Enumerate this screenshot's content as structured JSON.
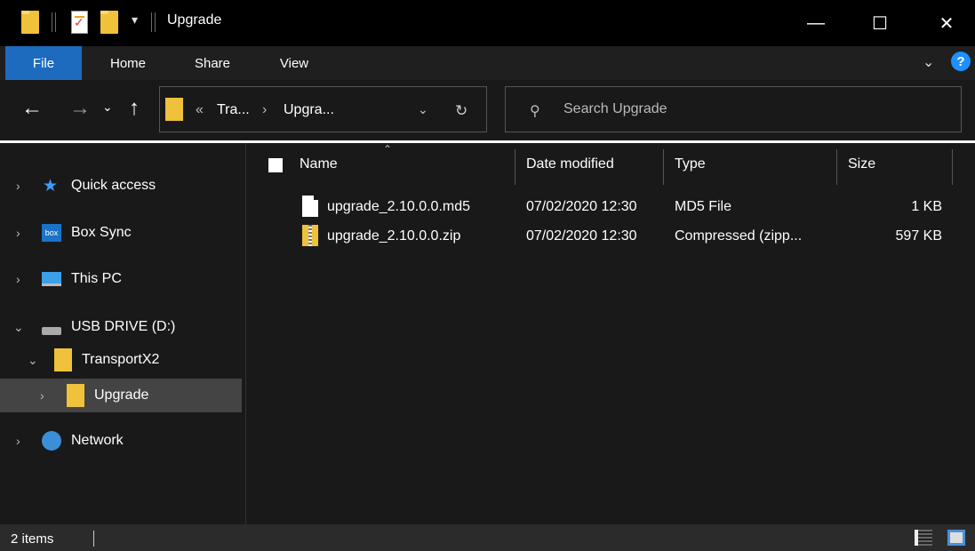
{
  "window": {
    "title": "Upgrade",
    "minimize": "—",
    "maximize": "☐",
    "close": "✕"
  },
  "ribbon": {
    "tabs": [
      "File",
      "Home",
      "Share",
      "View"
    ]
  },
  "address": {
    "overflow": "«",
    "segments": [
      "Tra...",
      "Upgra..."
    ],
    "separator": "›"
  },
  "search": {
    "placeholder": "Search Upgrade"
  },
  "nav": {
    "items": [
      {
        "label": "Quick access"
      },
      {
        "label": "Box Sync"
      },
      {
        "label": "This PC"
      },
      {
        "label": "USB DRIVE (D:)"
      },
      {
        "label": "TransportX2"
      },
      {
        "label": "Upgrade"
      },
      {
        "label": "Network"
      }
    ]
  },
  "columns": {
    "name": "Name",
    "date": "Date modified",
    "type": "Type",
    "size": "Size"
  },
  "files": [
    {
      "name": "upgrade_2.10.0.0.md5",
      "date": "07/02/2020 12:30",
      "type": "MD5 File",
      "size": "1 KB"
    },
    {
      "name": "upgrade_2.10.0.0.zip",
      "date": "07/02/2020 12:30",
      "type": "Compressed (zipp...",
      "size": "597 KB"
    }
  ],
  "status": {
    "text": "2 items"
  },
  "colors": {
    "accent": "#1c6bbf",
    "folder": "#f0c13a",
    "selected": "#444444"
  },
  "icons": {
    "box": "box"
  }
}
